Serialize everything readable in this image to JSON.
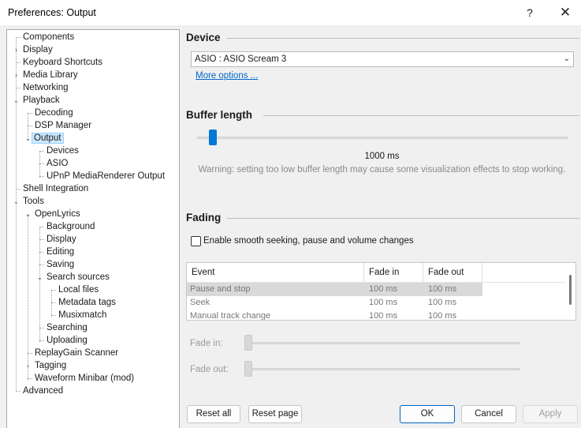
{
  "window": {
    "title": "Preferences: Output",
    "help_glyph": "?",
    "close_glyph": "✕"
  },
  "tree": {
    "items": [
      {
        "label": "Components"
      },
      {
        "label": "Display"
      },
      {
        "label": "Keyboard Shortcuts"
      },
      {
        "label": "Media Library"
      },
      {
        "label": "Networking"
      },
      {
        "label": "Playback"
      },
      {
        "label": "Decoding"
      },
      {
        "label": "DSP Manager"
      },
      {
        "label": "Output"
      },
      {
        "label": "Devices"
      },
      {
        "label": "ASIO"
      },
      {
        "label": "UPnP MediaRenderer Output"
      },
      {
        "label": "Shell Integration"
      },
      {
        "label": "Tools"
      },
      {
        "label": "OpenLyrics"
      },
      {
        "label": "Background"
      },
      {
        "label": "Display"
      },
      {
        "label": "Editing"
      },
      {
        "label": "Saving"
      },
      {
        "label": "Search sources"
      },
      {
        "label": "Local files"
      },
      {
        "label": "Metadata tags"
      },
      {
        "label": "Musixmatch"
      },
      {
        "label": "Searching"
      },
      {
        "label": "Uploading"
      },
      {
        "label": "ReplayGain Scanner"
      },
      {
        "label": "Tagging"
      },
      {
        "label": "Waveform Minibar (mod)"
      },
      {
        "label": "Advanced"
      }
    ]
  },
  "device": {
    "title": "Device",
    "selected": "ASIO : ASIO Scream 3",
    "more_options": "More options ..."
  },
  "buffer": {
    "title": "Buffer length",
    "value_label": "1000 ms",
    "warning": "Warning: setting too low buffer length may cause some visualization effects to stop working."
  },
  "fading": {
    "title": "Fading",
    "checkbox_label": "Enable smooth seeking, pause and volume changes",
    "checkbox_checked": false,
    "columns": [
      "Event",
      "Fade in",
      "Fade out"
    ],
    "rows": [
      {
        "event": "Pause and stop",
        "fade_in": "100 ms",
        "fade_out": "100 ms"
      },
      {
        "event": "Seek",
        "fade_in": "100 ms",
        "fade_out": "100 ms"
      },
      {
        "event": "Manual track change",
        "fade_in": "100 ms",
        "fade_out": "100 ms"
      }
    ],
    "fade_in_label": "Fade in:",
    "fade_out_label": "Fade out:"
  },
  "buttons": {
    "reset_all": "Reset all",
    "reset_page": "Reset page",
    "ok": "OK",
    "cancel": "Cancel",
    "apply": "Apply"
  }
}
